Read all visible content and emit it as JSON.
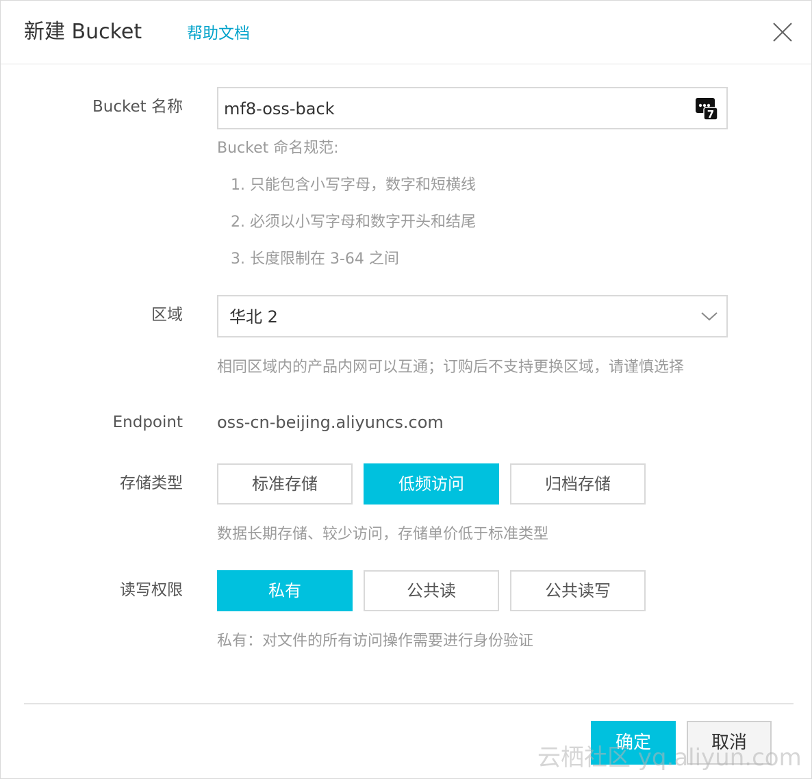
{
  "dialog": {
    "title": "新建 Bucket",
    "help_link": "帮助文档"
  },
  "bucket_name": {
    "label": "Bucket 名称",
    "value": "mf8-oss-back",
    "rules_title": "Bucket 命名规范:",
    "rules": [
      "1. 只能包含小写字母，数字和短横线",
      "2. 必须以小写字母和数字开头和结尾",
      "3. 长度限制在 3-64 之间"
    ]
  },
  "region": {
    "label": "区域",
    "selected": "华北 2",
    "hint": "相同区域内的产品内网可以互通；订购后不支持更换区域，请谨慎选择"
  },
  "endpoint": {
    "label": "Endpoint",
    "value": "oss-cn-beijing.aliyuncs.com"
  },
  "storage_type": {
    "label": "存储类型",
    "options": [
      "标准存储",
      "低频访问",
      "归档存储"
    ],
    "selected_index": 1,
    "hint": "数据长期存储、较少访问，存储单价低于标准类型"
  },
  "acl": {
    "label": "读写权限",
    "options": [
      "私有",
      "公共读",
      "公共读写"
    ],
    "selected_index": 0,
    "hint": "私有：对文件的所有访问操作需要进行身份验证"
  },
  "footer": {
    "ok_label": "确定",
    "cancel_label": "取消"
  },
  "watermark": "云栖社区 yq.aliyun.com",
  "colors": {
    "accent": "#00c1de",
    "link": "#00a2ca"
  }
}
